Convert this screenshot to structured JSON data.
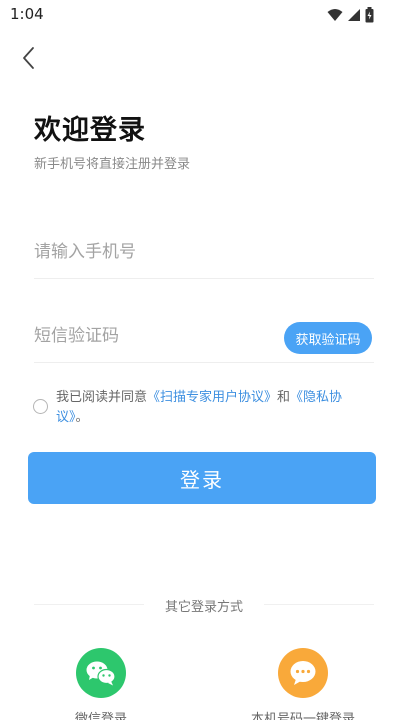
{
  "status_bar": {
    "time": "1:04",
    "icons": [
      "wifi-icon",
      "signal-icon",
      "battery-icon"
    ]
  },
  "header": {
    "back_icon": "chevron-left-icon"
  },
  "login": {
    "title": "欢迎登录",
    "subtitle": "新手机号将直接注册并登录",
    "phone_placeholder": "请输入手机号",
    "phone_value": "",
    "code_placeholder": "短信验证码",
    "code_value": "",
    "get_code_label": "获取验证码",
    "agreement": {
      "prefix": "我已阅读并同意",
      "terms_link": "《扫描专家用户协议》",
      "and": "和",
      "privacy_link": "《隐私协议》",
      "suffix": "。",
      "checked": false
    },
    "submit_label": "登录"
  },
  "other_login": {
    "title": "其它登录方式",
    "options": [
      {
        "label": "微信登录",
        "icon": "wechat-icon"
      },
      {
        "label": "本机号码一键登录",
        "icon": "chat-bubble-icon"
      }
    ]
  },
  "colors": {
    "accent": "#4aa3f5",
    "link": "#3d8fe0",
    "wechat": "#2dc76d",
    "onekey": "#f9a93a"
  }
}
